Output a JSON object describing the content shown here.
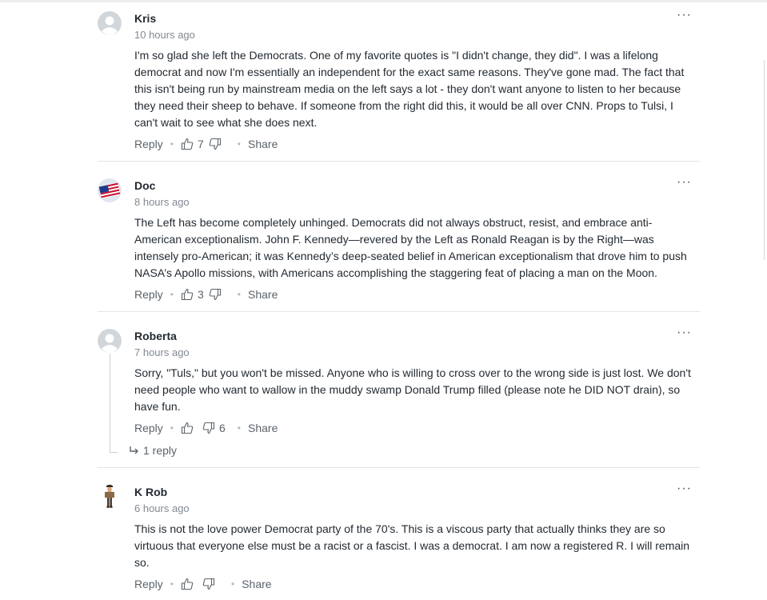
{
  "colors": {
    "text": "#232a31",
    "muted": "#828a93",
    "action": "#5b636a",
    "divider": "#e0e4e9"
  },
  "comments": [
    {
      "username": "Kris",
      "time": "10 hours ago",
      "body": "I'm so glad she left the Democrats. One of my favorite quotes is \"I didn't change, they did\". I was a lifelong democrat and now I'm essentially an independent for the exact same reasons. They've gone mad. The fact that this isn't being run by mainstream media on the left says a lot - they don't want anyone to listen to her because they need their sheep to behave. If someone from the right did this, it would be all over CNN. Props to Tulsi, I can't wait to see what she does next.",
      "reply_label": "Reply",
      "likes": "7",
      "dislikes": "",
      "share_label": "Share",
      "more_label": "···",
      "avatar": "default-avatar-icon"
    },
    {
      "username": "Doc",
      "time": "8 hours ago",
      "body": "The Left has become completely unhinged. Democrats did not always obstruct, resist, and embrace anti-American exceptionalism. John F. Kennedy—revered by the Left as Ronald Reagan is by the Right—was intensely pro-American; it was Kennedy’s deep-seated belief in American exceptionalism that drove him to push NASA’s Apollo missions, with Americans accomplishing the staggering feat of placing a man on the Moon.",
      "reply_label": "Reply",
      "likes": "3",
      "dislikes": "",
      "share_label": "Share",
      "more_label": "···",
      "avatar": "us-flag-avatar"
    },
    {
      "username": "Roberta",
      "time": "7 hours ago",
      "body": "Sorry, \"Tuls,\" but you won't be missed. Anyone who is willing to cross over to the wrong side is just lost. We don't need people who want to wallow in the muddy swamp Donald Trump filled (please note he DID NOT drain), so have fun.",
      "reply_label": "Reply",
      "likes": "",
      "dislikes": "6",
      "share_label": "Share",
      "more_label": "···",
      "avatar": "default-avatar-icon",
      "replies_label": "1 reply"
    },
    {
      "username": "K Rob",
      "time": "6 hours ago",
      "body": "This is not the love power Democrat party of the 70's.  This is a viscous party that actually thinks they are so virtuous that everyone else must be a racist or a fascist.  I was a democrat.  I am now a registered R.  I will remain so.",
      "reply_label": "Reply",
      "likes": "",
      "dislikes": "",
      "share_label": "Share",
      "more_label": "···",
      "avatar": "cowboy-figure-avatar"
    }
  ]
}
